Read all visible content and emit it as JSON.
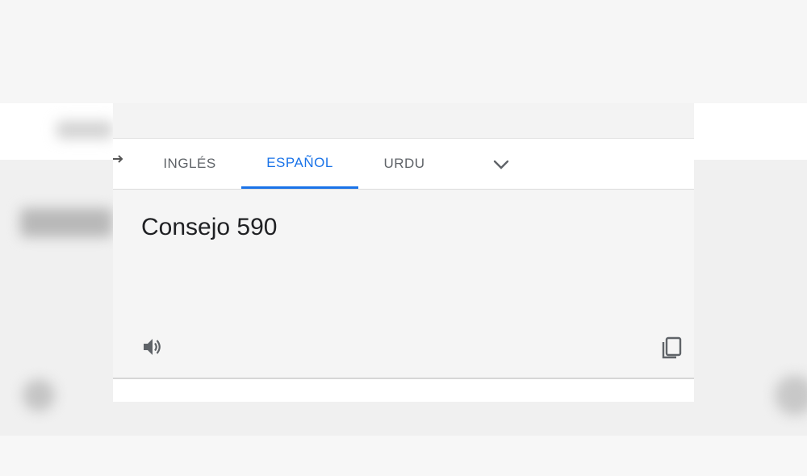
{
  "tabs": [
    {
      "label": "INGLÉS",
      "active": false
    },
    {
      "label": "ESPAÑOL",
      "active": true
    },
    {
      "label": "URDU",
      "active": false
    }
  ],
  "translation": {
    "text": "Consejo 590"
  },
  "icons": {
    "swap": "swap-arrow-icon",
    "more": "chevron-down-icon",
    "listen": "speaker-icon",
    "copy": "copy-icon"
  },
  "colors": {
    "accent": "#1a73e8",
    "text": "#202124",
    "tab_text": "#5f6368"
  }
}
